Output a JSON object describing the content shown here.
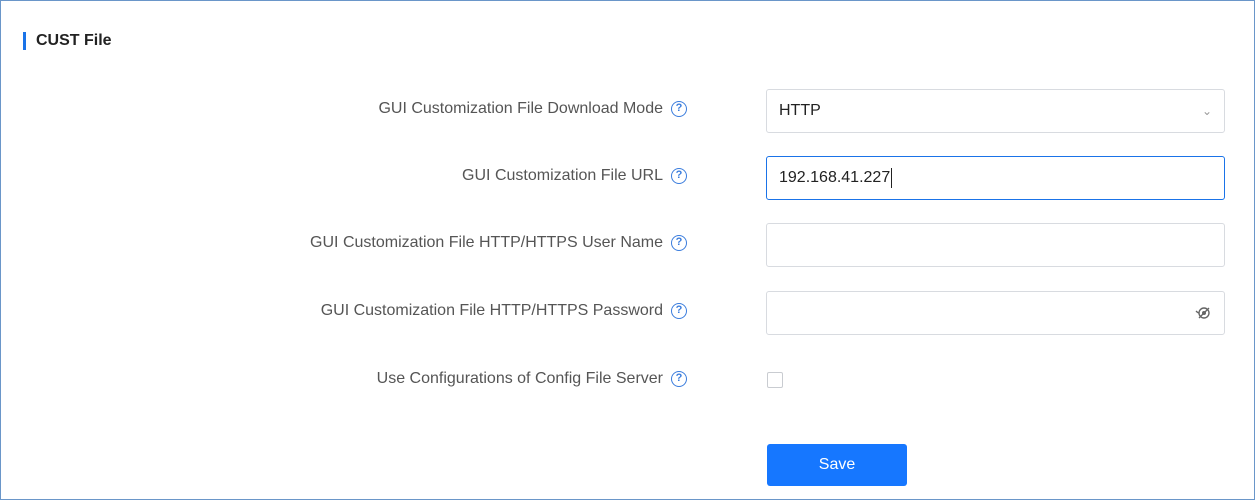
{
  "section": {
    "title": "CUST File"
  },
  "form": {
    "download_mode": {
      "label": "GUI Customization File Download Mode",
      "value": "HTTP"
    },
    "url": {
      "label": "GUI Customization File URL",
      "value": "192.168.41.227"
    },
    "username": {
      "label": "GUI Customization File HTTP/HTTPS User Name",
      "value": ""
    },
    "password": {
      "label": "GUI Customization File HTTP/HTTPS Password",
      "value": ""
    },
    "use_config_server": {
      "label": "Use Configurations of Config File Server",
      "checked": false
    }
  },
  "help_glyph": "?",
  "chevron_glyph": "⌄",
  "save_label": "Save",
  "colors": {
    "accent": "#1677ff",
    "frame": "#6a96c9"
  }
}
